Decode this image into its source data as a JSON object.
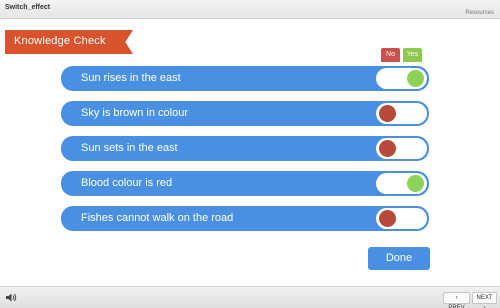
{
  "window": {
    "title": "Switch_effect",
    "resources_label": "Resources"
  },
  "banner": {
    "title": "Knowledge Check"
  },
  "columns": {
    "no_label": "No",
    "yes_label": "Yes"
  },
  "rows": [
    {
      "label": "Sun rises in the east",
      "state": "yes"
    },
    {
      "label": "Sky is brown in colour",
      "state": "no"
    },
    {
      "label": "Sun sets in the east",
      "state": "no"
    },
    {
      "label": "Blood colour is red",
      "state": "yes"
    },
    {
      "label": "Fishes cannot walk on the road",
      "state": "no"
    }
  ],
  "done_label": "Done",
  "footer": {
    "speaker_icon": "speaker-icon",
    "prev_label": "‹ PREV",
    "next_label": "NEXT ›"
  },
  "colors": {
    "row_blue": "#4a90e2",
    "banner": "#d9532c",
    "yes_green": "#8dd157",
    "no_red": "#b84a3c"
  }
}
